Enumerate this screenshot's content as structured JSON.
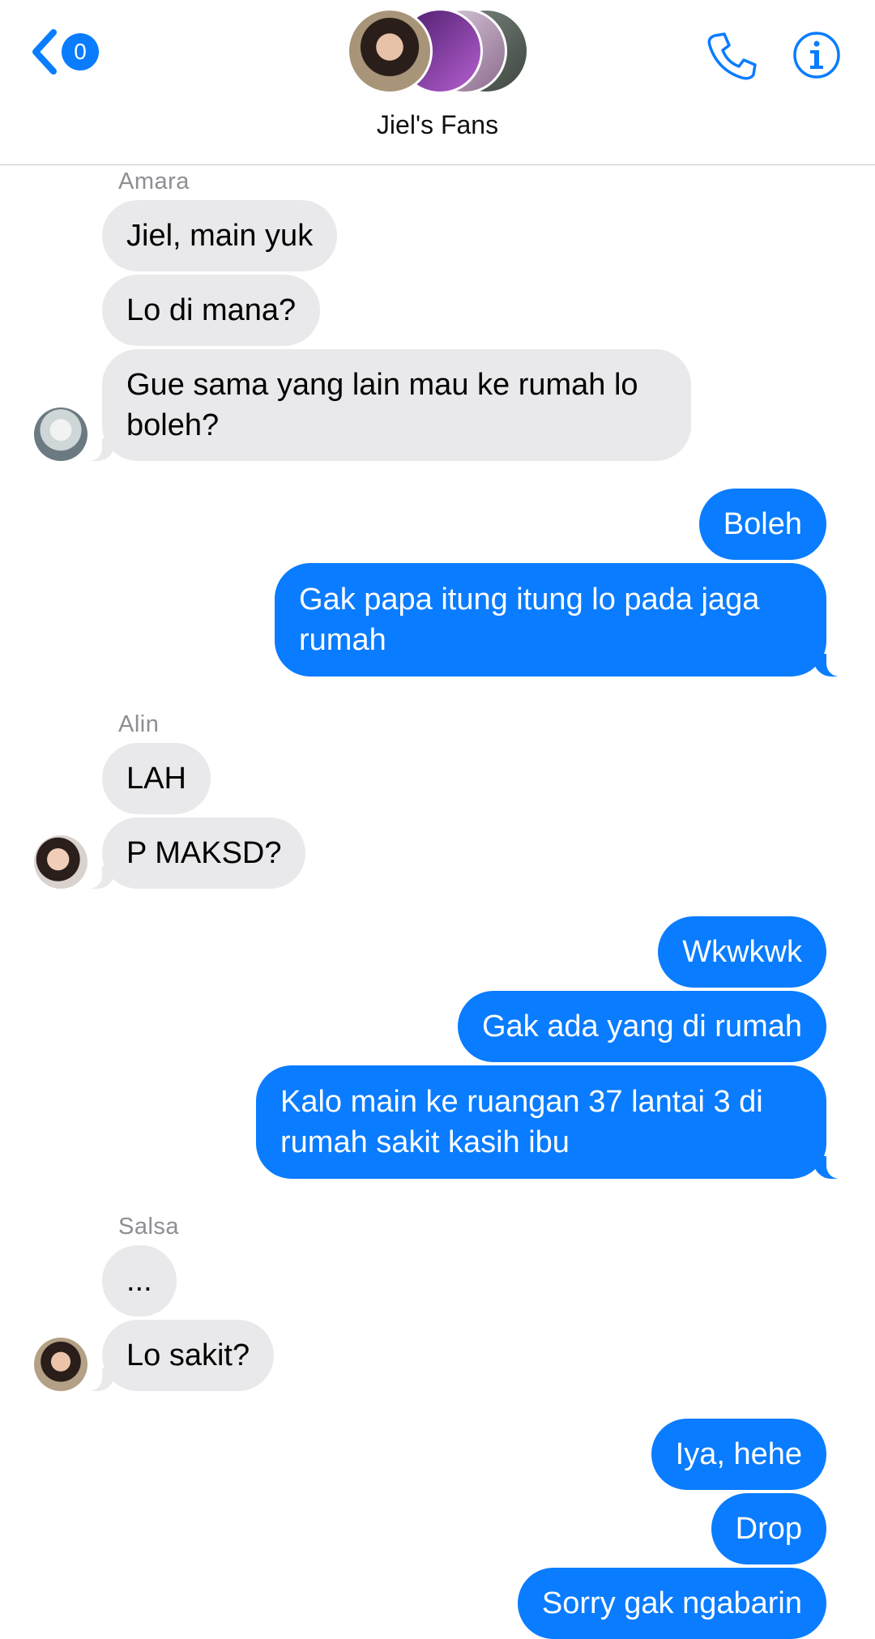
{
  "header": {
    "unread_count": "0",
    "group_name": "Jiel's Fans",
    "icons": [
      "back-chevron-icon",
      "phone-icon",
      "info-icon"
    ]
  },
  "colors": {
    "accent": "#0a7cff",
    "incoming_bubble": "#e9e9eb",
    "sender_label": "#8e8e93"
  },
  "messages": {
    "m1": {
      "sender": "Amara",
      "text": "Jiel, main yuk"
    },
    "m2": {
      "text": "Lo di mana?"
    },
    "m3": {
      "text": "Gue sama yang lain mau ke rumah lo boleh?"
    },
    "m4": {
      "text": "Boleh"
    },
    "m5": {
      "text": "Gak papa itung itung lo pada jaga rumah"
    },
    "m6": {
      "sender": "Alin",
      "text": "LAH"
    },
    "m7": {
      "text": "P MAKSD?"
    },
    "m8": {
      "text": "Wkwkwk"
    },
    "m9": {
      "text": "Gak ada yang di rumah"
    },
    "m10": {
      "text": "Kalo main ke ruangan 37 lantai 3 di rumah sakit kasih ibu"
    },
    "m11": {
      "sender": "Salsa",
      "text": "..."
    },
    "m12": {
      "text": "Lo sakit?"
    },
    "m13": {
      "text": "Iya, hehe"
    },
    "m14": {
      "text": "Drop"
    },
    "m15": {
      "text": "Sorry gak ngabarin"
    }
  }
}
